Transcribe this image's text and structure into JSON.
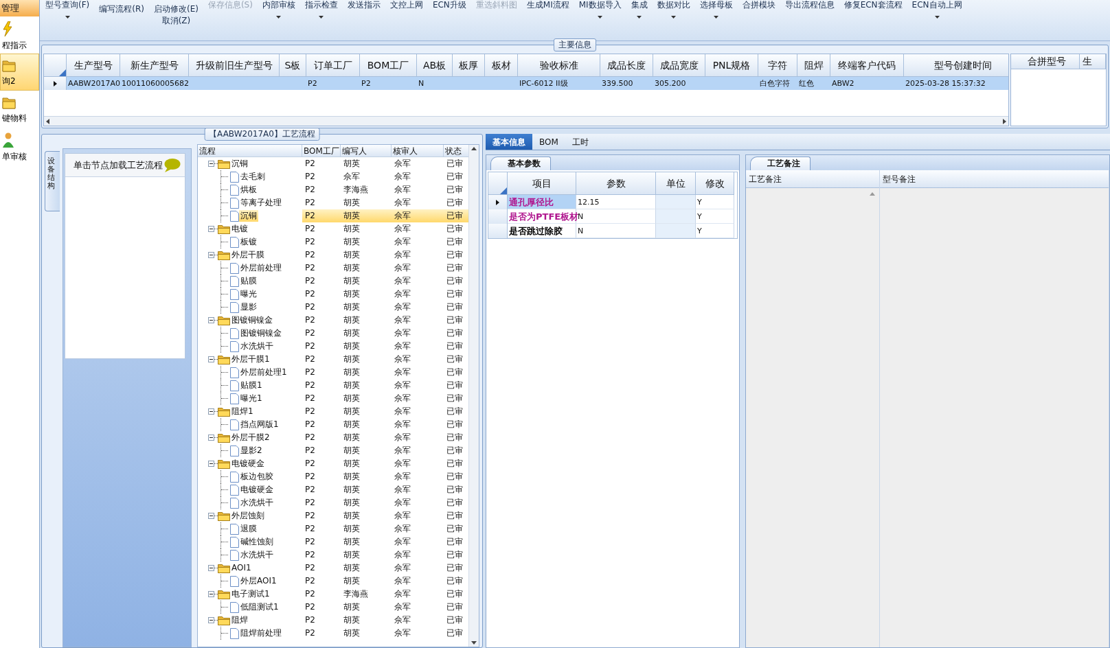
{
  "sidebar": {
    "header": "管理",
    "items": [
      {
        "label": "程指示",
        "kind": "bolt",
        "selected": false
      },
      {
        "label": "询2",
        "kind": "folder",
        "selected": true
      },
      {
        "label": "键物料",
        "kind": "folder",
        "selected": false
      },
      {
        "label": "单审核",
        "kind": "person",
        "selected": false
      }
    ]
  },
  "toolbar": [
    {
      "kind": "large",
      "caret": true,
      "buttons": [
        {
          "label": "型号查询(F)",
          "disabled": false
        }
      ]
    },
    {
      "kind": "small",
      "caret": false,
      "buttons": [
        {
          "label": "编写流程(R)",
          "disabled": false
        }
      ]
    },
    {
      "kind": "small",
      "caret": false,
      "buttons": [
        {
          "label": "启动修改(E)",
          "disabled": false
        },
        {
          "label": "取消(Z)",
          "disabled": false
        }
      ]
    },
    {
      "kind": "large",
      "caret": false,
      "buttons": [
        {
          "label": "保存信息(S)",
          "disabled": true
        }
      ]
    },
    {
      "kind": "large",
      "caret": true,
      "buttons": [
        {
          "label": "内部审核",
          "disabled": false
        }
      ]
    },
    {
      "kind": "large",
      "caret": true,
      "buttons": [
        {
          "label": "指示检查",
          "disabled": false
        }
      ]
    },
    {
      "kind": "large",
      "caret": false,
      "buttons": [
        {
          "label": "发送指示",
          "disabled": false
        }
      ]
    },
    {
      "kind": "large",
      "caret": false,
      "buttons": [
        {
          "label": "文控上网",
          "disabled": false
        }
      ]
    },
    {
      "kind": "large",
      "caret": false,
      "buttons": [
        {
          "label": "ECN升级",
          "disabled": false
        }
      ]
    },
    {
      "kind": "large",
      "caret": false,
      "buttons": [
        {
          "label": "重选斜料图",
          "disabled": true
        }
      ]
    },
    {
      "kind": "large",
      "caret": false,
      "buttons": [
        {
          "label": "生成MI流程",
          "disabled": false
        }
      ]
    },
    {
      "kind": "large",
      "caret": true,
      "buttons": [
        {
          "label": "MI数据导入",
          "disabled": false
        }
      ]
    },
    {
      "kind": "large",
      "caret": true,
      "buttons": [
        {
          "label": "集成",
          "disabled": false
        }
      ]
    },
    {
      "kind": "large",
      "caret": true,
      "buttons": [
        {
          "label": "数据对比",
          "disabled": false
        }
      ]
    },
    {
      "kind": "large",
      "caret": true,
      "buttons": [
        {
          "label": "选择母板",
          "disabled": false
        }
      ]
    },
    {
      "kind": "large",
      "caret": false,
      "buttons": [
        {
          "label": "合拼模块",
          "disabled": false
        }
      ]
    },
    {
      "kind": "large",
      "caret": false,
      "buttons": [
        {
          "label": "导出流程信息",
          "disabled": false
        }
      ]
    },
    {
      "kind": "large",
      "caret": false,
      "buttons": [
        {
          "label": "修复ECN套流程",
          "disabled": false
        }
      ]
    },
    {
      "kind": "large",
      "caret": true,
      "buttons": [
        {
          "label": "ECN自动上网",
          "disabled": false
        }
      ]
    }
  ],
  "main_info": {
    "title": "主要信息",
    "columns": [
      "生产型号",
      "新生产型号",
      "升级前旧生产型号",
      "S板",
      "订单工厂",
      "BOM工厂",
      "AB板",
      "板厚",
      "板材",
      "验收标准",
      "成品长度",
      "成品宽度",
      "PNL规格",
      "字符",
      "阻焊",
      "终端客户代码",
      "型号创建时间"
    ],
    "rows": [
      {
        "selected": true,
        "cells": [
          "AABW2017A0",
          "10011060005682",
          null,
          null,
          "P2",
          "P2",
          "N",
          null,
          null,
          "IPC-6012 II级",
          "339.500",
          "305.200",
          null,
          "白色字符",
          "红色",
          "ABW2",
          "2025-03-28 15:37:32"
        ]
      }
    ],
    "merge_panel": {
      "columns": [
        "合拼型号",
        "生"
      ]
    }
  },
  "process": {
    "title": "【AABW2017A0】工艺流程",
    "side_tab": "设备结构",
    "hint": "单击节点加载工艺流程",
    "tree": {
      "columns": [
        "流程",
        "BOM工厂",
        "编写人",
        "核审人",
        "状态"
      ],
      "nodes": [
        {
          "label": "沉铜",
          "bom": "P2",
          "writer": "胡英",
          "reviewer": "佘军",
          "status": "已审",
          "selected": false,
          "expanded": true,
          "children": [
            {
              "label": "去毛刺",
              "bom": "P2",
              "writer": "佘军",
              "reviewer": "佘军",
              "status": "已审",
              "selected": false
            },
            {
              "label": "烘板",
              "bom": "P2",
              "writer": "李海燕",
              "reviewer": "佘军",
              "status": "已审",
              "selected": false
            },
            {
              "label": "等离子处理",
              "bom": "P2",
              "writer": "胡英",
              "reviewer": "佘军",
              "status": "已审",
              "selected": false
            },
            {
              "label": "沉铜",
              "bom": "P2",
              "writer": "胡英",
              "reviewer": "佘军",
              "status": "已审",
              "selected": true
            }
          ]
        },
        {
          "label": "电镀",
          "bom": "P2",
          "writer": "胡英",
          "reviewer": "佘军",
          "status": "已审",
          "selected": false,
          "expanded": true,
          "children": [
            {
              "label": "板镀",
              "bom": "P2",
              "writer": "胡英",
              "reviewer": "佘军",
              "status": "已审",
              "selected": false
            }
          ]
        },
        {
          "label": "外层干膜",
          "bom": "P2",
          "writer": "胡英",
          "reviewer": "佘军",
          "status": "已审",
          "selected": false,
          "expanded": true,
          "children": [
            {
              "label": "外层前处理",
              "bom": "P2",
              "writer": "胡英",
              "reviewer": "佘军",
              "status": "已审",
              "selected": false
            },
            {
              "label": "贴膜",
              "bom": "P2",
              "writer": "胡英",
              "reviewer": "佘军",
              "status": "已审",
              "selected": false
            },
            {
              "label": "曝光",
              "bom": "P2",
              "writer": "胡英",
              "reviewer": "佘军",
              "status": "已审",
              "selected": false
            },
            {
              "label": "显影",
              "bom": "P2",
              "writer": "胡英",
              "reviewer": "佘军",
              "status": "已审",
              "selected": false
            }
          ]
        },
        {
          "label": "图镀铜镍金",
          "bom": "P2",
          "writer": "胡英",
          "reviewer": "佘军",
          "status": "已审",
          "selected": false,
          "expanded": true,
          "children": [
            {
              "label": "图镀铜镍金",
              "bom": "P2",
              "writer": "胡英",
              "reviewer": "佘军",
              "status": "已审",
              "selected": false
            },
            {
              "label": "水洗烘干",
              "bom": "P2",
              "writer": "胡英",
              "reviewer": "佘军",
              "status": "已审",
              "selected": false
            }
          ]
        },
        {
          "label": "外层干膜1",
          "bom": "P2",
          "writer": "胡英",
          "reviewer": "佘军",
          "status": "已审",
          "selected": false,
          "expanded": true,
          "children": [
            {
              "label": "外层前处理1",
              "bom": "P2",
              "writer": "胡英",
              "reviewer": "佘军",
              "status": "已审",
              "selected": false
            },
            {
              "label": "贴膜1",
              "bom": "P2",
              "writer": "胡英",
              "reviewer": "佘军",
              "status": "已审",
              "selected": false
            },
            {
              "label": "曝光1",
              "bom": "P2",
              "writer": "胡英",
              "reviewer": "佘军",
              "status": "已审",
              "selected": false
            }
          ]
        },
        {
          "label": "阻焊1",
          "bom": "P2",
          "writer": "胡英",
          "reviewer": "佘军",
          "status": "已审",
          "selected": false,
          "expanded": true,
          "children": [
            {
              "label": "挡点网版1",
              "bom": "P2",
              "writer": "胡英",
              "reviewer": "佘军",
              "status": "已审",
              "selected": false
            }
          ]
        },
        {
          "label": "外层干膜2",
          "bom": "P2",
          "writer": "胡英",
          "reviewer": "佘军",
          "status": "已审",
          "selected": false,
          "expanded": true,
          "children": [
            {
              "label": "显影2",
              "bom": "P2",
              "writer": "胡英",
              "reviewer": "佘军",
              "status": "已审",
              "selected": false
            }
          ]
        },
        {
          "label": "电镀硬金",
          "bom": "P2",
          "writer": "胡英",
          "reviewer": "佘军",
          "status": "已审",
          "selected": false,
          "expanded": true,
          "children": [
            {
              "label": "板边包胶",
              "bom": "P2",
              "writer": "胡英",
              "reviewer": "佘军",
              "status": "已审",
              "selected": false
            },
            {
              "label": "电镀硬金",
              "bom": "P2",
              "writer": "胡英",
              "reviewer": "佘军",
              "status": "已审",
              "selected": false
            },
            {
              "label": "水洗烘干",
              "bom": "P2",
              "writer": "胡英",
              "reviewer": "佘军",
              "status": "已审",
              "selected": false
            }
          ]
        },
        {
          "label": "外层蚀刻",
          "bom": "P2",
          "writer": "胡英",
          "reviewer": "佘军",
          "status": "已审",
          "selected": false,
          "expanded": true,
          "children": [
            {
              "label": "退膜",
              "bom": "P2",
              "writer": "胡英",
              "reviewer": "佘军",
              "status": "已审",
              "selected": false
            },
            {
              "label": "碱性蚀刻",
              "bom": "P2",
              "writer": "胡英",
              "reviewer": "佘军",
              "status": "已审",
              "selected": false
            },
            {
              "label": "水洗烘干",
              "bom": "P2",
              "writer": "胡英",
              "reviewer": "佘军",
              "status": "已审",
              "selected": false
            }
          ]
        },
        {
          "label": "AOI1",
          "bom": "P2",
          "writer": "胡英",
          "reviewer": "佘军",
          "status": "已审",
          "selected": false,
          "expanded": true,
          "children": [
            {
              "label": "外层AOI1",
              "bom": "P2",
              "writer": "胡英",
              "reviewer": "佘军",
              "status": "已审",
              "selected": false
            }
          ]
        },
        {
          "label": "电子测试1",
          "bom": "P2",
          "writer": "李海燕",
          "reviewer": "佘军",
          "status": "已审",
          "selected": false,
          "expanded": true,
          "children": [
            {
              "label": "低阻测试1",
              "bom": "P2",
              "writer": "胡英",
              "reviewer": "佘军",
              "status": "已审",
              "selected": false
            }
          ]
        },
        {
          "label": "阻焊",
          "bom": "P2",
          "writer": "胡英",
          "reviewer": "佘军",
          "status": "已审",
          "selected": false,
          "expanded": true,
          "children": [
            {
              "label": "阻焊前处理",
              "bom": "P2",
              "writer": "胡英",
              "reviewer": "佘军",
              "status": "已审",
              "selected": false
            }
          ]
        }
      ]
    }
  },
  "detail": {
    "tabs": [
      {
        "label": "基本信息",
        "selected": true
      },
      {
        "label": "BOM",
        "selected": false
      },
      {
        "label": "工时",
        "selected": false
      }
    ],
    "params": {
      "title": "基本参数",
      "columns": [
        "项目",
        "参数",
        "单位",
        "修改"
      ],
      "rows": [
        {
          "item": "通孔厚径比",
          "color": "#b0178f",
          "value": "12.15",
          "modified": "Y",
          "selected": true
        },
        {
          "item": "是否为PTFE板材",
          "color": "#b0178f",
          "value": "N",
          "modified": "Y",
          "selected": false
        },
        {
          "item": "是否跳过除胶",
          "color": "#000000",
          "value": "N",
          "modified": "Y",
          "selected": false
        }
      ]
    },
    "remarks": {
      "title": "工艺备注",
      "columns": [
        "工艺备注",
        "型号备注"
      ]
    }
  }
}
